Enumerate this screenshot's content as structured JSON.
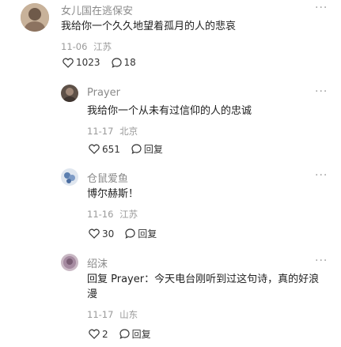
{
  "comments": [
    {
      "username": "女儿国在逃保安",
      "text": "我给你一个久久地望着孤月的人的悲哀",
      "date": "11-06",
      "location": "江苏",
      "likes": "1023",
      "replies": "18",
      "more": "···"
    },
    {
      "username": "Prayer",
      "text": "我给你一个从未有过信仰的人的忠诚",
      "date": "11-17",
      "location": "北京",
      "likes": "651",
      "reply_label": "回复",
      "more": "···"
    },
    {
      "username": "仓鼠爱鱼",
      "text": "博尔赫斯！",
      "date": "11-16",
      "location": "江苏",
      "likes": "30",
      "reply_label": "回复",
      "more": "···"
    },
    {
      "username": "绍沫",
      "reply_prefix": "回复 Prayer：",
      "text": "今天电台刚听到过这句诗，真的好浪漫",
      "date": "11-17",
      "location": "山东",
      "likes": "2",
      "reply_label": "回复",
      "more": "···"
    }
  ],
  "colors": {
    "text": "#1f1f1f",
    "muted": "#9a9a9a",
    "username": "#8a8a8a"
  }
}
